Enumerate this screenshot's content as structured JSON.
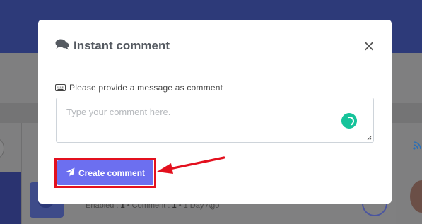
{
  "background": {
    "meta": {
      "enabled_label": "Enabled :",
      "enabled_value": "1",
      "comment_label": "Comment :",
      "comment_value": "1",
      "time": "1 Day Ago"
    },
    "rss_icon": "rss-icon"
  },
  "modal": {
    "title": "Instant comment",
    "title_icon": "comments-icon",
    "close_icon": "close-icon",
    "field_label": "Please provide a message as comment",
    "field_icon": "keyboard-icon",
    "textarea": {
      "placeholder": "Type your comment here.",
      "value": ""
    },
    "create_button": {
      "label": "Create comment",
      "icon": "paper-plane-icon"
    }
  },
  "annotation": {
    "highlight_color": "#e3101e",
    "arrow_color": "#e3101e"
  },
  "colors": {
    "header": "#2d3a79",
    "button": "#6c6ff0",
    "grammarly": "#15c39a"
  }
}
